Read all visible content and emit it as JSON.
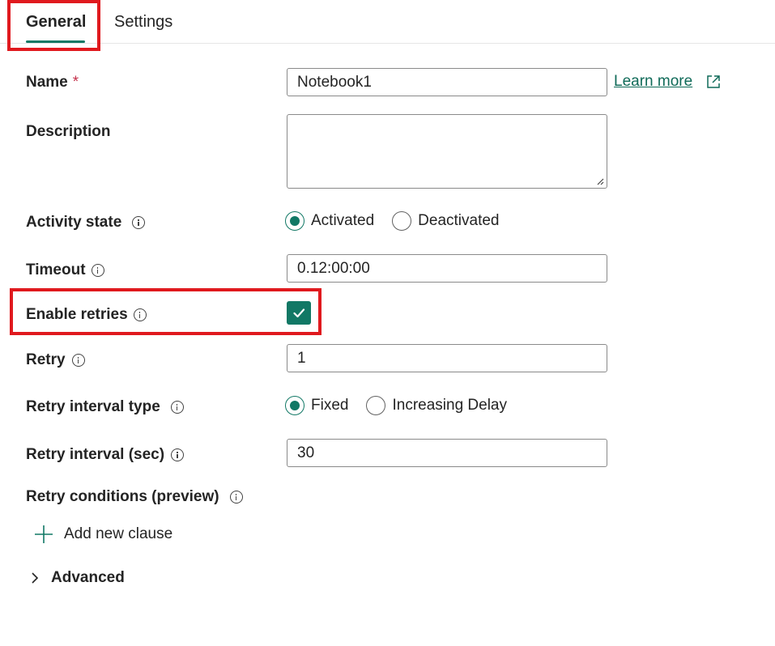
{
  "tabs": {
    "general": "General",
    "settings": "Settings"
  },
  "name": {
    "label": "Name",
    "required_mark": "*",
    "value": "Notebook1",
    "learn_more": "Learn more"
  },
  "description": {
    "label": "Description",
    "value": ""
  },
  "activity_state": {
    "label": "Activity state",
    "options": [
      "Activated",
      "Deactivated"
    ],
    "selected": "Activated"
  },
  "timeout": {
    "label": "Timeout",
    "value": "0.12:00:00"
  },
  "enable_retries": {
    "label": "Enable retries",
    "checked": true
  },
  "retry": {
    "label": "Retry",
    "value": "1"
  },
  "retry_interval_type": {
    "label": "Retry interval type",
    "options": [
      "Fixed",
      "Increasing Delay"
    ],
    "selected": "Fixed"
  },
  "retry_interval": {
    "label": "Retry interval (sec)",
    "value": "30"
  },
  "retry_conditions": {
    "label": "Retry conditions (preview)",
    "add_clause": "Add new clause"
  },
  "advanced": {
    "label": "Advanced"
  },
  "colors": {
    "accent": "#117865",
    "highlight": "#e0191e",
    "required": "#c4314b"
  },
  "icons": [
    "info-icon",
    "external-link-icon",
    "checkmark-icon",
    "plus-icon",
    "chevron-right-icon",
    "resize-grip-icon"
  ]
}
